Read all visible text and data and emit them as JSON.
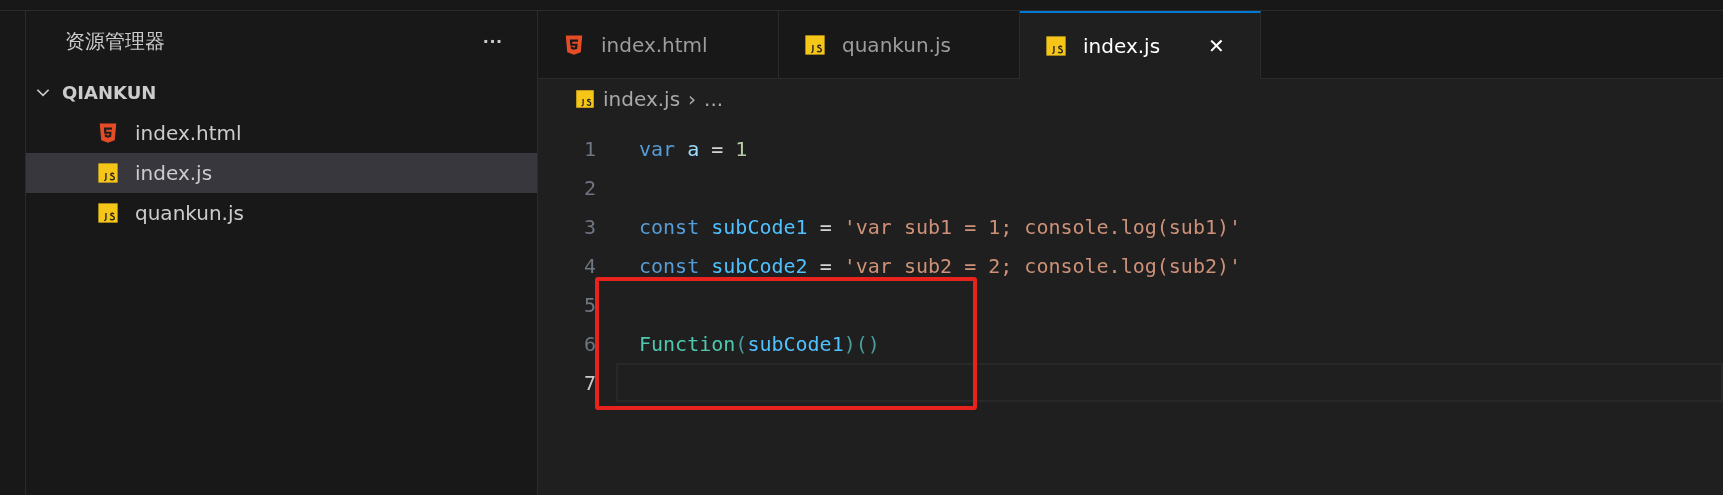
{
  "sidebar": {
    "title": "资源管理器",
    "more": "···",
    "folder": {
      "name": "QIANKUN",
      "expanded": true,
      "children": [
        {
          "name": "index.html",
          "kind": "html",
          "selected": false
        },
        {
          "name": "index.js",
          "kind": "js",
          "selected": true
        },
        {
          "name": "quankun.js",
          "kind": "js",
          "selected": false
        }
      ]
    }
  },
  "tabs": [
    {
      "label": "index.html",
      "kind": "html",
      "selected": false
    },
    {
      "label": "quankun.js",
      "kind": "js",
      "selected": false
    },
    {
      "label": "index.js",
      "kind": "js",
      "selected": true,
      "close": "✕"
    }
  ],
  "breadcrumb": {
    "file": "index.js",
    "kind": "js",
    "separator": "›",
    "rest": "..."
  },
  "code": {
    "lines": [
      {
        "number": "1",
        "current": false,
        "tokens": [
          {
            "text": "var",
            "kind": "keyword"
          },
          {
            "text": " a",
            "kind": "variable"
          },
          {
            "text": " = ",
            "kind": "plain"
          },
          {
            "text": "1",
            "kind": "number"
          }
        ]
      },
      {
        "number": "2",
        "current": false
      },
      {
        "number": "3",
        "current": false,
        "tokens": [
          {
            "text": "const",
            "kind": "keyword"
          },
          {
            "text": " subCode1",
            "kind": "constant"
          },
          {
            "text": " = ",
            "kind": "plain"
          },
          {
            "text": "'var sub1 = 1; console.log(sub1)'",
            "kind": "string"
          }
        ]
      },
      {
        "number": "4",
        "current": false,
        "tokens": [
          {
            "text": "const",
            "kind": "keyword"
          },
          {
            "text": " subCode2",
            "kind": "constant"
          },
          {
            "text": " = ",
            "kind": "plain"
          },
          {
            "text": "'var sub2 = 2; console.log(sub2)'",
            "kind": "string"
          }
        ]
      }
    ],
    "boxed": {
      "color": "#e8231e",
      "lines": [
        {
          "number": "5",
          "current": false
        },
        {
          "number": "6",
          "current": false,
          "tokens": [
            {
              "text": "Function",
              "kind": "type"
            },
            {
              "text": "(",
              "kind": "paren"
            },
            {
              "text": "subCode1",
              "kind": "constant"
            },
            {
              "text": ")()",
              "kind": "paren"
            }
          ]
        },
        {
          "number": "7",
          "current": true
        }
      ]
    }
  }
}
